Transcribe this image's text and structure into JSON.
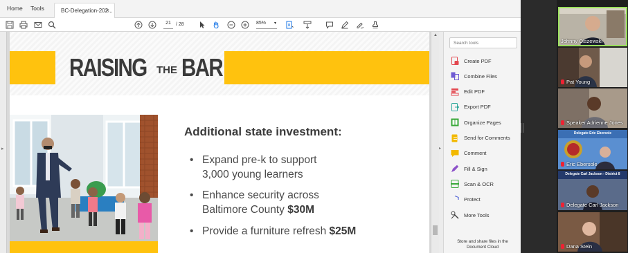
{
  "app": {
    "nav": {
      "home": "Home",
      "tools": "Tools"
    },
    "tab": {
      "title": "BC-Delegation-202...",
      "close": "×"
    }
  },
  "toolbar": {
    "page_current": "21",
    "page_total": "/ 28",
    "zoom": "85%",
    "zoom_arrow": "▾"
  },
  "slide": {
    "title_part1": "RAISING",
    "title_part2": "THE",
    "title_part3": "BAR",
    "heading": "Additional state investment:",
    "bullets": [
      {
        "line1": "Expand pre-k to support",
        "line2": "3,000 young learners",
        "amount": ""
      },
      {
        "line1": "Enhance security across",
        "line2": "Baltimore County",
        "amount": "$30M"
      },
      {
        "line1": "Provide a furniture refresh",
        "line2": "",
        "amount": "$25M"
      }
    ],
    "bullet_char": "•"
  },
  "tools_pane": {
    "search_placeholder": "Search tools",
    "items": [
      {
        "label": "Create PDF",
        "color": "#e34850"
      },
      {
        "label": "Combine Files",
        "color": "#6f5bd3"
      },
      {
        "label": "Edit PDF",
        "color": "#e34850"
      },
      {
        "label": "Export PDF",
        "color": "#2fa89b"
      },
      {
        "label": "Organize Pages",
        "color": "#39a839"
      },
      {
        "label": "Send for Comments",
        "color": "#f2b900"
      },
      {
        "label": "Comment",
        "color": "#f2b900"
      },
      {
        "label": "Fill & Sign",
        "color": "#8c52c9"
      },
      {
        "label": "Scan & OCR",
        "color": "#39a839"
      },
      {
        "label": "Protect",
        "color": "#5466d6"
      },
      {
        "label": "More Tools",
        "color": "#444444"
      }
    ],
    "cloud_line1": "Store and share files in the",
    "cloud_line2": "Document Cloud"
  },
  "participants": [
    {
      "name": "Johnny Olszewski",
      "active": true
    },
    {
      "name": "Pat Young",
      "active": false
    },
    {
      "name": "Speaker Adrienne Jones",
      "active": false
    },
    {
      "name": "Eric Ebersole",
      "active": false,
      "banner": "Delegate Eric Ebersole"
    },
    {
      "name": "Delegate Carl Jackson",
      "active": false,
      "banner": "Delegate Carl Jackson - District 8"
    },
    {
      "name": "Dana Stein",
      "active": false
    }
  ],
  "colors": {
    "accent_yellow": "#ffc20e",
    "active_speaker": "#9be15d"
  }
}
